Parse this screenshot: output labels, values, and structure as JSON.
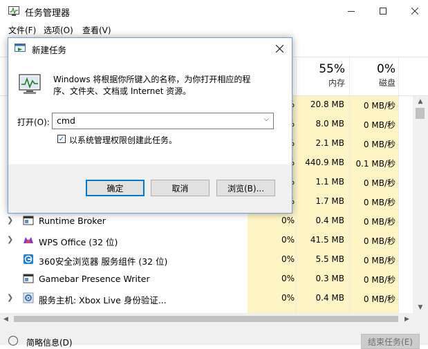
{
  "window": {
    "title": "任务管理器",
    "menu": [
      "文件(F)",
      "选项(O)",
      "查看(V)"
    ]
  },
  "columns": {
    "memory": {
      "percent": "55%",
      "label": "内存"
    },
    "disk": {
      "percent": "0%",
      "label": "磁盘"
    }
  },
  "rows": [
    {
      "name": "",
      "cpu": "0%",
      "memory": "20.8 MB",
      "disk": "0 MB/秒",
      "expandable": false
    },
    {
      "name": "",
      "cpu": "0%",
      "memory": "8.0 MB",
      "disk": "0 MB/秒",
      "expandable": false
    },
    {
      "name": "",
      "cpu": "0%",
      "memory": "2.1 MB",
      "disk": "0 MB/秒",
      "expandable": false
    },
    {
      "name": "",
      "cpu": "0%",
      "memory": "440.9 MB",
      "disk": "0.1 MB/秒",
      "expandable": false
    },
    {
      "name": "",
      "cpu": "0%",
      "memory": "1.1 MB",
      "disk": "0 MB/秒",
      "expandable": false
    },
    {
      "name": "",
      "cpu": "0%",
      "memory": "1.7 MB",
      "disk": "0 MB/秒",
      "expandable": false
    },
    {
      "name": "Runtime Broker",
      "cpu": "0%",
      "memory": "0.4 MB",
      "disk": "0 MB/秒",
      "expandable": true,
      "icon": "window-icon"
    },
    {
      "name": "WPS Office (32 位)",
      "cpu": "0%",
      "memory": "41.5 MB",
      "disk": "0 MB/秒",
      "expandable": true,
      "icon": "wps-icon"
    },
    {
      "name": "360安全浏览器 服务组件 (32 位)",
      "cpu": "0%",
      "memory": "5.5 MB",
      "disk": "0 MB/秒",
      "expandable": false,
      "icon": "browser-360-icon"
    },
    {
      "name": "Gamebar Presence Writer",
      "cpu": "0%",
      "memory": "0.3 MB",
      "disk": "0 MB/秒",
      "expandable": false,
      "icon": "window-icon"
    },
    {
      "name": "服务主机: Xbox Live 身份验证...",
      "cpu": "0%",
      "memory": "0.4 MB",
      "disk": "0 MB/秒",
      "expandable": true,
      "icon": "gear-icon"
    }
  ],
  "footer": {
    "details": "简略信息(D)",
    "end_task": "结束任务(E)"
  },
  "run_dialog": {
    "title": "新建任务",
    "description": "Windows 将根据你所键入的名称，为你打开相应的程序、文件夹、文档或 Internet 资源。",
    "open_label": "打开(O):",
    "input_value": "cmd",
    "admin_checkbox_label": "以系统管理权限创建此任务。",
    "admin_checked": true,
    "ok": "确定",
    "cancel": "取消",
    "browse": "浏览(B)..."
  },
  "colors": {
    "highlight_column": "#fff4c4",
    "accent": "#0078d7"
  }
}
